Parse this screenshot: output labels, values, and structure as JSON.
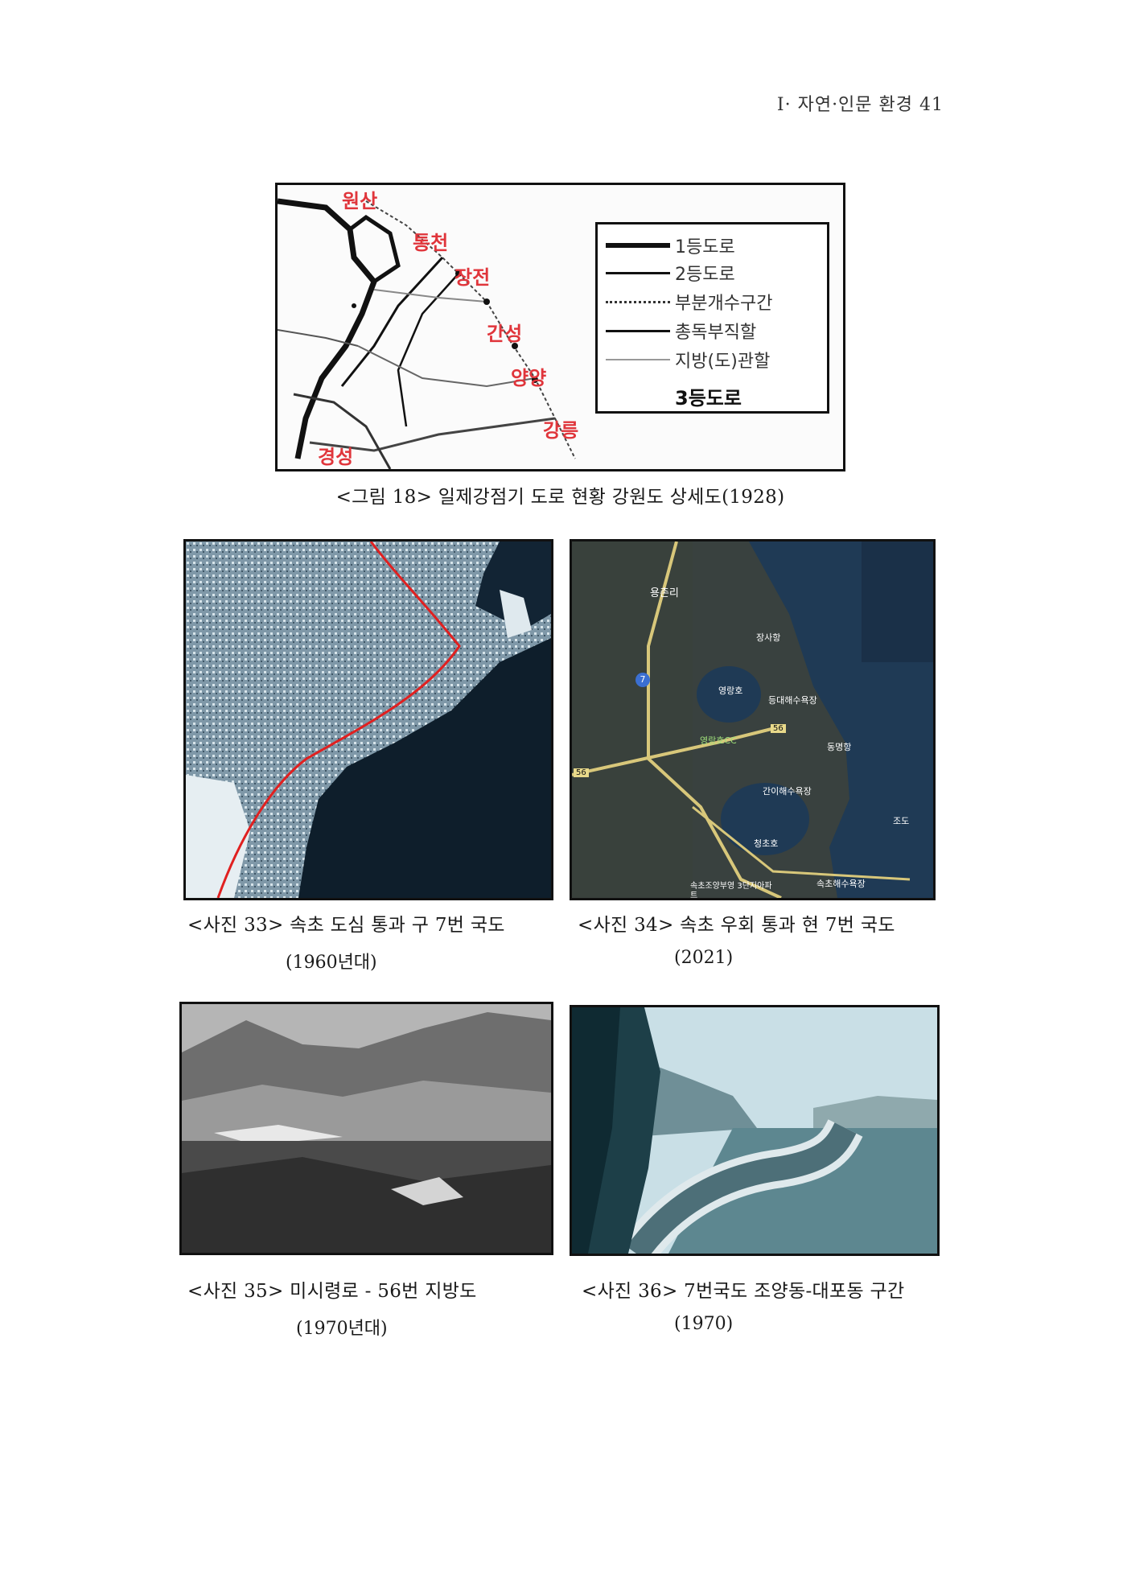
{
  "header": {
    "running_title": "Ⅰ· 자연·인문 환경  41"
  },
  "figure18": {
    "caption": "<그림 18> 일제강점기 도로 현황 강원도 상세도(1928)",
    "city_labels": [
      "원산",
      "통천",
      "장전",
      "간성",
      "양양",
      "강릉",
      "경성"
    ],
    "legend": [
      {
        "label": "1등도로",
        "style": "thick"
      },
      {
        "label": "2등도로",
        "style": "medium"
      },
      {
        "label": "부분개수구간",
        "style": "dotted"
      },
      {
        "label": "총독부직할",
        "style": "medium"
      },
      {
        "label": "지방(도)관할",
        "style": "thin"
      }
    ],
    "legend_bold": "3등도로"
  },
  "photo33": {
    "caption_line1": "<사진 33> 속초 도심 통과 구 7번 국도",
    "caption_line2": "(1960년대)"
  },
  "photo34": {
    "caption_line1": "<사진 34> 속초 우회 통과 현 7번 국도",
    "caption_line2": "(2021)",
    "map_labels": [
      "용촌리",
      "장사항",
      "영랑호",
      "등대해수욕장",
      "영랑호CC",
      "56",
      "동명항",
      "56",
      "간이해수욕장",
      "조도",
      "청초호",
      "속초해수욕장",
      "속초조양부영 3단지아파트",
      "7"
    ]
  },
  "photo35": {
    "caption_line1": "<사진 35> 미시령로 - 56번 지방도",
    "caption_line2": "(1970년대)"
  },
  "photo36": {
    "caption_line1": "<사진 36> 7번국도 조양동-대포동 구간",
    "caption_line2": "(1970)"
  }
}
